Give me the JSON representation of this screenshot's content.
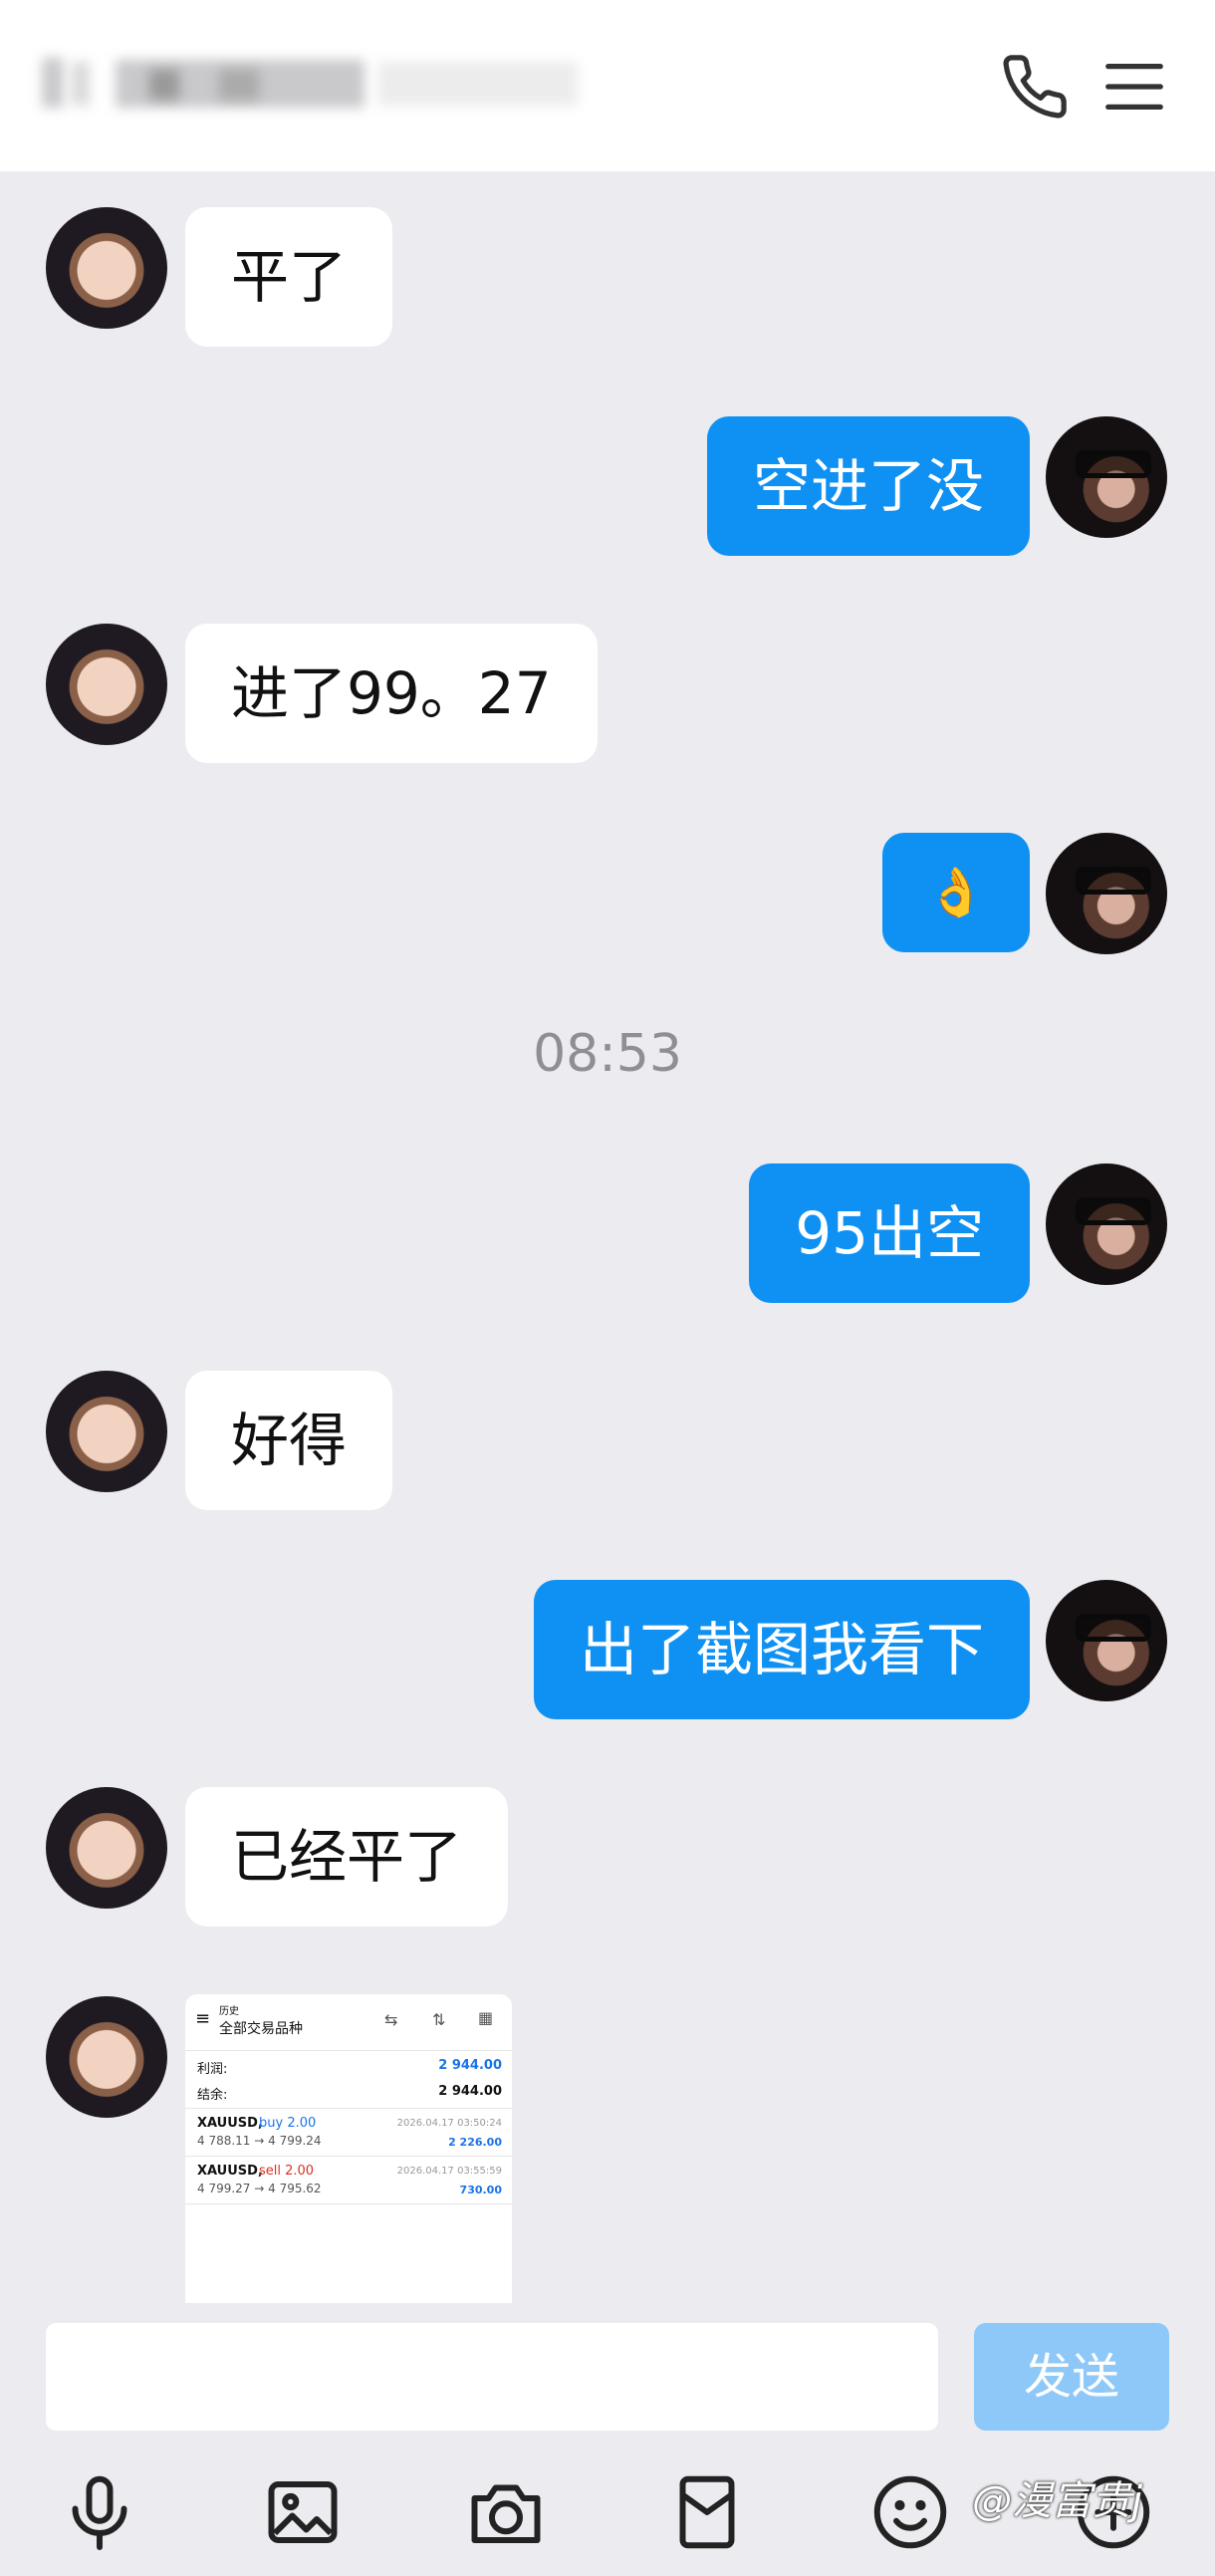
{
  "header": {
    "contact_name": "",
    "call_icon": "phone-icon",
    "menu_icon": "menu-icon"
  },
  "messages": [
    {
      "side": "in",
      "text": "平了"
    },
    {
      "side": "out",
      "text": "空进了没"
    },
    {
      "side": "in",
      "text": "进了99。27"
    },
    {
      "side": "out",
      "text": "👌"
    },
    {
      "side": "out",
      "text": "95出空"
    },
    {
      "side": "in",
      "text": "好得"
    },
    {
      "side": "out",
      "text": "出了截图我看下"
    },
    {
      "side": "in",
      "text": "已经平了"
    }
  ],
  "timestamp": "08:53",
  "screenshot": {
    "title_small": "历史",
    "title": "全部交易品种",
    "profit_label": "利润:",
    "profit_value": "2 944.00",
    "balance_label": "结余:",
    "balance_value": "2 944.00",
    "trades": [
      {
        "symbol": "XAUUSD,",
        "side": "buy 2.00",
        "side_color": "#1a73e8",
        "time": "2026.04.17 03:50:24",
        "prices": "4 788.11 → 4 799.24",
        "profit": "2 226.00"
      },
      {
        "symbol": "XAUUSD,",
        "side": "sell 2.00",
        "side_color": "#d93025",
        "time": "2026.04.17 03:55:59",
        "prices": "4 799.27 → 4 795.62",
        "profit": "730.00"
      }
    ]
  },
  "composer": {
    "input_value": "",
    "send_label": "发送"
  },
  "toolbar": [
    "mic-icon",
    "image-icon",
    "camera-icon",
    "red-packet-icon",
    "emoji-icon",
    "plus-icon"
  ],
  "watermark": "@漫富贵j",
  "colors": {
    "outgoing_bubble": "#0f91f4",
    "incoming_bubble": "#ffffff",
    "send_button_disabled": "#8dc8f8",
    "background": "#ebebf0"
  }
}
